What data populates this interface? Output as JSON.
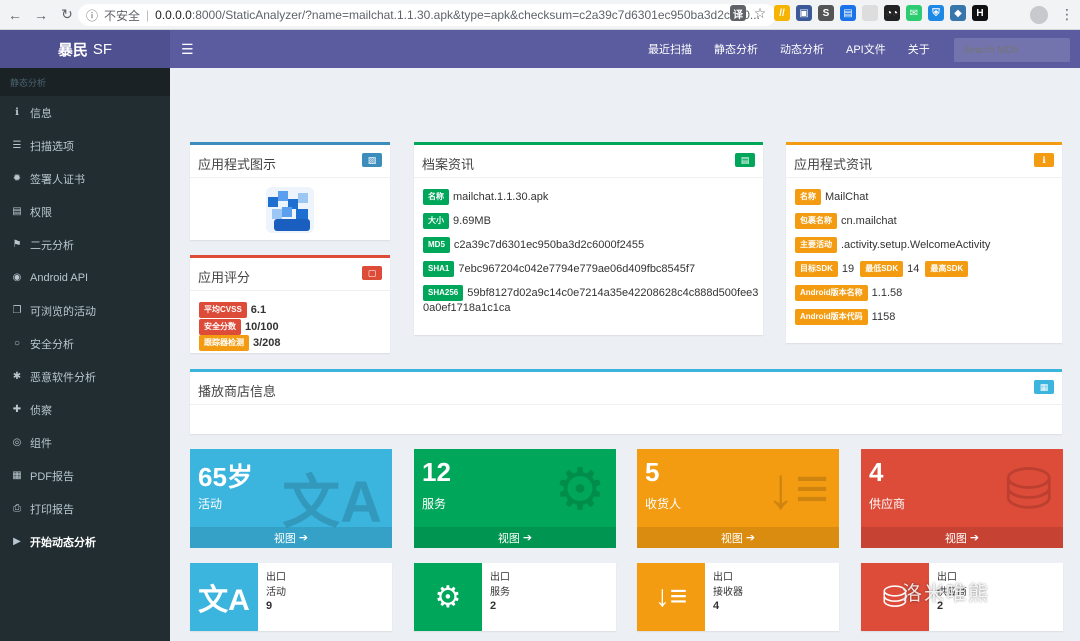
{
  "browser": {
    "security_label": "不安全",
    "url_host": "0.0.0.0",
    "url_path": ":8000/StaticAnalyzer/?name=mailchat.1.1.30.apk&type=apk&checksum=c2a39c7d6301ec950ba3d2c600..."
  },
  "header": {
    "brand_bold": "暴民",
    "brand_light": "SF",
    "nav": [
      "最近扫描",
      "静态分析",
      "动态分析",
      "API文件",
      "关于"
    ],
    "search_placeholder": "Search MD5"
  },
  "sidebar": {
    "section_label": "静态分析",
    "items": [
      {
        "label": "信息",
        "icon": "info-icon",
        "glyph": "ℹ"
      },
      {
        "label": "扫描选项",
        "icon": "list-icon",
        "glyph": "☰"
      },
      {
        "label": "签署人证书",
        "icon": "certificate-icon",
        "glyph": "✹"
      },
      {
        "label": "权限",
        "icon": "list-icon",
        "glyph": "▤"
      },
      {
        "label": "二元分析",
        "icon": "flag-icon",
        "glyph": "⚑"
      },
      {
        "label": "Android API",
        "icon": "circle-icon",
        "glyph": "◉"
      },
      {
        "label": "可浏览的活动",
        "icon": "copy-icon",
        "glyph": "❐"
      },
      {
        "label": "安全分析",
        "icon": "circle-o-icon",
        "glyph": "○"
      },
      {
        "label": "恶意软件分析",
        "icon": "bug-icon",
        "glyph": "✱"
      },
      {
        "label": "侦察",
        "icon": "plus-icon",
        "glyph": "✚"
      },
      {
        "label": "组件",
        "icon": "component-icon",
        "glyph": "◎"
      },
      {
        "label": "PDF报告",
        "icon": "file-icon",
        "glyph": "▦"
      },
      {
        "label": "打印报告",
        "icon": "print-icon",
        "glyph": "⎙"
      },
      {
        "label": "开始动态分析",
        "icon": "play-icon",
        "glyph": "▶"
      }
    ]
  },
  "app_icon_box": {
    "title": "应用程式图示",
    "badge_icon": "image-icon"
  },
  "score_box": {
    "title": "应用评分",
    "badge_icon": "stop-icon",
    "rows": [
      {
        "label": "平均CVSS",
        "value": "6.1"
      },
      {
        "label": "安全分数",
        "value": "10/100"
      },
      {
        "label": "跟踪器检测",
        "value": "3/208"
      }
    ]
  },
  "file_box": {
    "title": "档案资讯",
    "badge_icon": "file-icon",
    "rows": [
      {
        "label": "名称",
        "value": "mailchat.1.1.30.apk"
      },
      {
        "label": "大小",
        "value": "9.69MB"
      },
      {
        "label": "MD5",
        "value": "c2a39c7d6301ec950ba3d2c6000f2455"
      },
      {
        "label": "SHA1",
        "value": "7ebc967204c042e7794e779ae06d409fbc8545f7"
      },
      {
        "label": "SHA256",
        "value_line1": "59bf8127d02a9c14c0e7214a35e42208628c4c888d500fee3",
        "value_line2": "0a0ef1718a1c1ca"
      }
    ]
  },
  "app_info_box": {
    "title": "应用程式资讯",
    "badge_icon": "info-icon",
    "rows": [
      {
        "label": "名称",
        "value": "MailChat"
      },
      {
        "label": "包裹名称",
        "value": "cn.mailchat"
      },
      {
        "label": "主要活动",
        "value": ".activity.setup.WelcomeActivity"
      }
    ],
    "sdk": {
      "target_label": "目标SDK",
      "target": "19",
      "min_label": "最低SDK",
      "min": "14",
      "max_label": "最高SDK"
    },
    "version_name_label": "Android版本名称",
    "version_name": "1.1.58",
    "version_code_label": "Android版本代码",
    "version_code": "1158"
  },
  "play_store_box": {
    "title": "播放商店信息",
    "badge_icon": "grid-icon"
  },
  "stats": [
    {
      "number": "65岁",
      "caption": "活动",
      "footer": "视图",
      "color": "#3bb4de",
      "icon": "translate-icon",
      "glyph": "文A"
    },
    {
      "number": "12",
      "caption": "服务",
      "footer": "视图",
      "color": "#00a65a",
      "icon": "gears-icon",
      "glyph": "⚙"
    },
    {
      "number": "5",
      "caption": "收货人",
      "footer": "视图",
      "color": "#f39c12",
      "icon": "sort-icon",
      "glyph": "↓≡"
    },
    {
      "number": "4",
      "caption": "供应商",
      "footer": "视图",
      "color": "#dd4b39",
      "icon": "database-icon",
      "glyph": "⛁"
    }
  ],
  "exports": [
    {
      "t1": "出口",
      "t2": "活动",
      "t3": "9",
      "color": "#3bb4de",
      "icon": "translate-icon",
      "glyph": "文A"
    },
    {
      "t1": "出口",
      "t2": "服务",
      "t3": "2",
      "color": "#00a65a",
      "icon": "gears-icon",
      "glyph": "⚙"
    },
    {
      "t1": "出口",
      "t2": "接收器",
      "t3": "4",
      "color": "#f39c12",
      "icon": "sort-icon",
      "glyph": "↓≡"
    },
    {
      "t1": "出口",
      "t2": "供应商",
      "t3": "2",
      "color": "#dd4b39",
      "icon": "database-icon",
      "glyph": "⛁"
    }
  ],
  "watermark": "洛米唯熊"
}
